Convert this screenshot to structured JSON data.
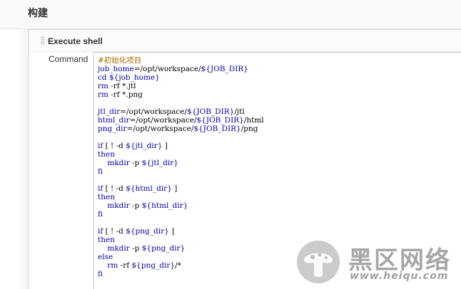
{
  "section": {
    "title": "构建"
  },
  "builder": {
    "title": "Execute shell",
    "field_label": "Command",
    "code_lines": [
      "#初始化项目",
      "job_home=/opt/workspace/${JOB_DIR}",
      "cd ${job_home}",
      "rm -rf *.jtl",
      "rm -rf *.png",
      "",
      "jtl_dir=/opt/workspace/${JOB_DIR}/jtl",
      "html_dir=/opt/workspace/${JOB_DIR}/html",
      "png_dir=/opt/workspace/${JOB_DIR}/png",
      "",
      "if [ ! -d ${jtl_dir} ]",
      "then",
      "    mkdir -p ${jtl_dir}",
      "fi",
      "",
      "if [ ! -d ${html_dir} ]",
      "then",
      "    mkdir -p ${html_dir}",
      "fi",
      "",
      "if [ ! -d ${png_dir} ]",
      "then",
      "    mkdir -p ${png_dir}",
      "else",
      "    rm -rf ${png_dir}/*",
      "fi"
    ]
  },
  "watermark": {
    "title": "黑区网络",
    "url": "www.heiqu.com"
  },
  "colors": {
    "keyword": "#0000aa",
    "comment": "#a66f00",
    "text": "#000000",
    "watermark": "#969696"
  },
  "icons": {
    "drag_handle": "drag-handle-icon",
    "watermark_logo": "mushroom-logo-icon"
  }
}
